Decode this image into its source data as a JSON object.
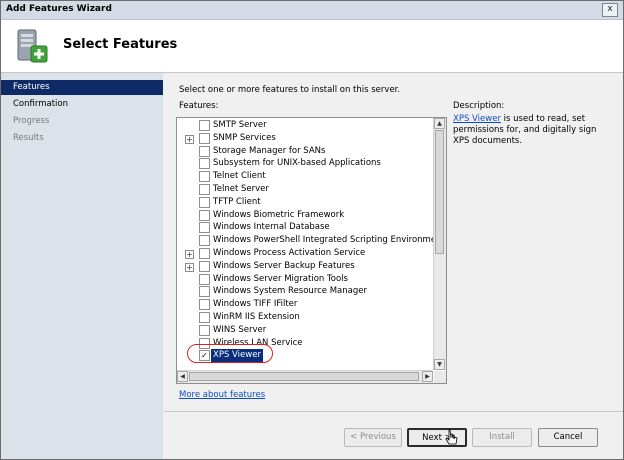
{
  "window": {
    "title": "Add Features Wizard",
    "close_glyph": "x"
  },
  "header": {
    "title": "Select Features",
    "icon": "server-add-icon"
  },
  "nav": [
    {
      "label": "Features",
      "state": "active"
    },
    {
      "label": "Confirmation",
      "state": "normal"
    },
    {
      "label": "Progress",
      "state": "disabled"
    },
    {
      "label": "Results",
      "state": "disabled"
    }
  ],
  "main": {
    "instruction": "Select one or more features to install on this server.",
    "features_label": "Features:",
    "description_label": "Description:",
    "description": {
      "link_text": "XPS Viewer",
      "text": " is used to read, set permissions for, and digitally sign XPS documents."
    },
    "more_link": "More about features",
    "features": [
      {
        "label": "SMTP Server",
        "expander": false,
        "checked": false
      },
      {
        "label": "SNMP Services",
        "expander": true,
        "checked": false
      },
      {
        "label": "Storage Manager for SANs",
        "expander": false,
        "checked": false
      },
      {
        "label": "Subsystem for UNIX-based Applications",
        "expander": false,
        "checked": false
      },
      {
        "label": "Telnet Client",
        "expander": false,
        "checked": false
      },
      {
        "label": "Telnet Server",
        "expander": false,
        "checked": false
      },
      {
        "label": "TFTP Client",
        "expander": false,
        "checked": false
      },
      {
        "label": "Windows Biometric Framework",
        "expander": false,
        "checked": false
      },
      {
        "label": "Windows Internal Database",
        "expander": false,
        "checked": false
      },
      {
        "label": "Windows PowerShell Integrated Scripting Environment (IS",
        "expander": false,
        "checked": false
      },
      {
        "label": "Windows Process Activation Service",
        "expander": true,
        "checked": false
      },
      {
        "label": "Windows Server Backup Features",
        "expander": true,
        "checked": false
      },
      {
        "label": "Windows Server Migration Tools",
        "expander": false,
        "checked": false
      },
      {
        "label": "Windows System Resource Manager",
        "expander": false,
        "checked": false
      },
      {
        "label": "Windows TIFF IFilter",
        "expander": false,
        "checked": false
      },
      {
        "label": "WinRM IIS Extension",
        "expander": false,
        "checked": false
      },
      {
        "label": "WINS Server",
        "expander": false,
        "checked": false
      },
      {
        "label": "Wireless LAN Service",
        "expander": false,
        "checked": false
      },
      {
        "label": "XPS Viewer",
        "expander": false,
        "checked": true,
        "selected": true
      }
    ]
  },
  "buttons": {
    "previous": "< Previous",
    "next": "Next >",
    "install": "Install",
    "cancel": "Cancel"
  },
  "colors": {
    "nav_active": "#0e2a66",
    "selection": "#0a2d7e",
    "link": "#0b4ec8",
    "highlight_oval": "#e02020"
  }
}
